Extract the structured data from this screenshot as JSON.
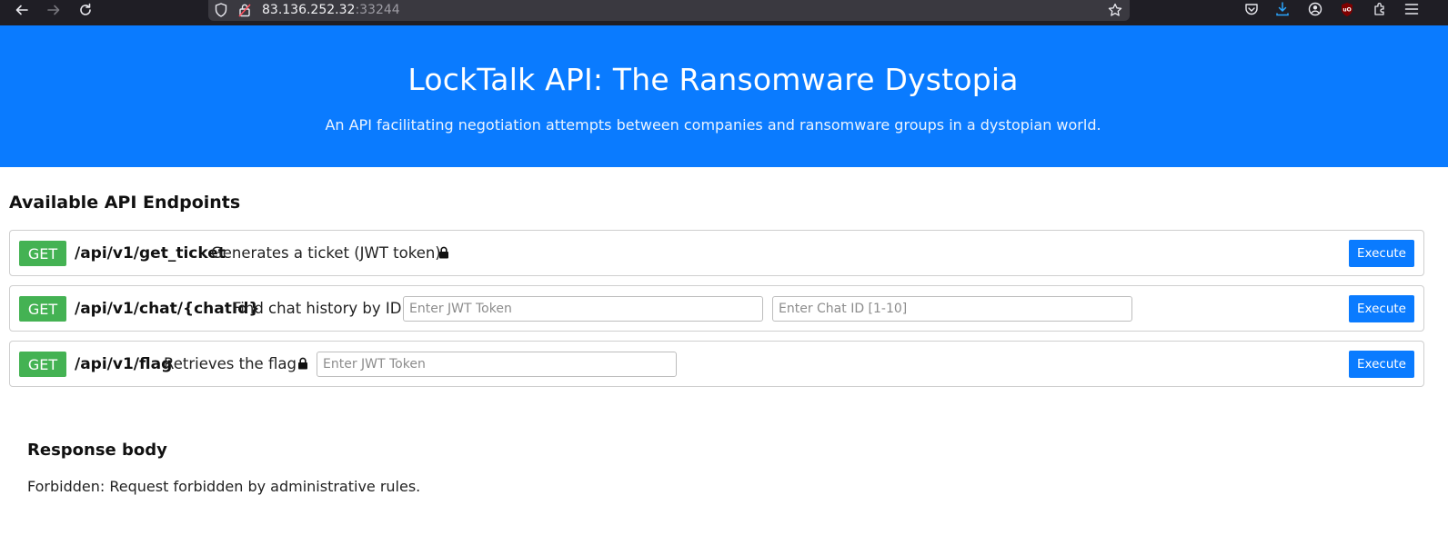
{
  "browser": {
    "url_host": "83.136.252.32",
    "url_port": ":33244",
    "icons": {
      "back": "back-arrow-icon",
      "forward": "forward-arrow-icon",
      "reload": "reload-icon",
      "shield": "tracking-shield-icon",
      "insecure": "insecure-lock-icon",
      "bookmark": "star-icon",
      "pocket": "pocket-icon",
      "download": "download-icon",
      "account": "account-icon",
      "ublock": "ublock-icon",
      "extensions": "extensions-icon",
      "menu": "hamburger-menu-icon"
    },
    "colors": {
      "chrome": "#1f1e25",
      "urlbar": "#3a3940",
      "download_accent": "#2aa5ff",
      "ublock": "#800000"
    }
  },
  "hero": {
    "title": "LockTalk API: The Ransomware Dystopia",
    "subtitle": "An API facilitating negotiation attempts between companies and ransomware groups in a dystopian world.",
    "background": "#0a7bff"
  },
  "endpoints_section": {
    "title": "Available API Endpoints",
    "items": [
      {
        "method": "GET",
        "path": "/api/v1/get_ticket",
        "description": "Generates a ticket (JWT token)",
        "locked": true,
        "execute_label": "Execute"
      },
      {
        "method": "GET",
        "path": "/api/v1/chat/{chatId}",
        "description": "Find chat history by ID",
        "locked": false,
        "inputs": [
          {
            "placeholder": "Enter JWT Token",
            "value": ""
          },
          {
            "placeholder": "Enter Chat ID [1-10]",
            "value": ""
          }
        ],
        "execute_label": "Execute"
      },
      {
        "method": "GET",
        "path": "/api/v1/flag",
        "description": "Retrieves the flag",
        "locked": true,
        "inputs": [
          {
            "placeholder": "Enter JWT Token",
            "value": ""
          }
        ],
        "execute_label": "Execute"
      }
    ],
    "colors": {
      "method_get": "#44b253",
      "execute": "#0a7bff"
    }
  },
  "response": {
    "title": "Response body",
    "body": "Forbidden: Request forbidden by administrative rules."
  }
}
